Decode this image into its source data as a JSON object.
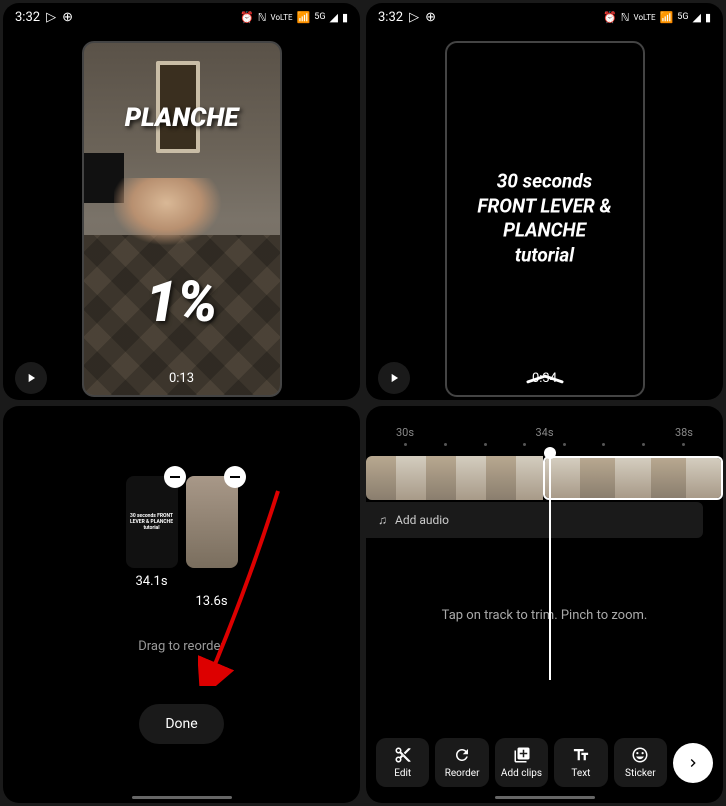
{
  "status_bar": {
    "time": "3:32"
  },
  "preview": {
    "left": {
      "title": "PLANCHE",
      "percent": "1%",
      "timestamp": "0:13"
    },
    "right": {
      "text_line1": "30 seconds",
      "text_line2": "FRONT LEVER & PLANCHE",
      "text_line3": "tutorial",
      "timestamp": "0:34"
    }
  },
  "reorder": {
    "clips": [
      {
        "text": "30 seconds FRONT LEVER & PLANCHE tutorial",
        "duration": "34.1s"
      },
      {
        "duration": "13.6s"
      }
    ],
    "hint": "Drag to reorder",
    "done_label": "Done"
  },
  "editor": {
    "ruler": [
      "30s",
      "34s",
      "38s"
    ],
    "audio_label": "Add audio",
    "hint": "Tap on track to trim. Pinch to zoom.",
    "tools": [
      {
        "name": "edit",
        "label": "Edit"
      },
      {
        "name": "reorder",
        "label": "Reorder"
      },
      {
        "name": "add-clips",
        "label": "Add clips"
      },
      {
        "name": "text",
        "label": "Text"
      },
      {
        "name": "sticker",
        "label": "Sticker"
      }
    ]
  }
}
